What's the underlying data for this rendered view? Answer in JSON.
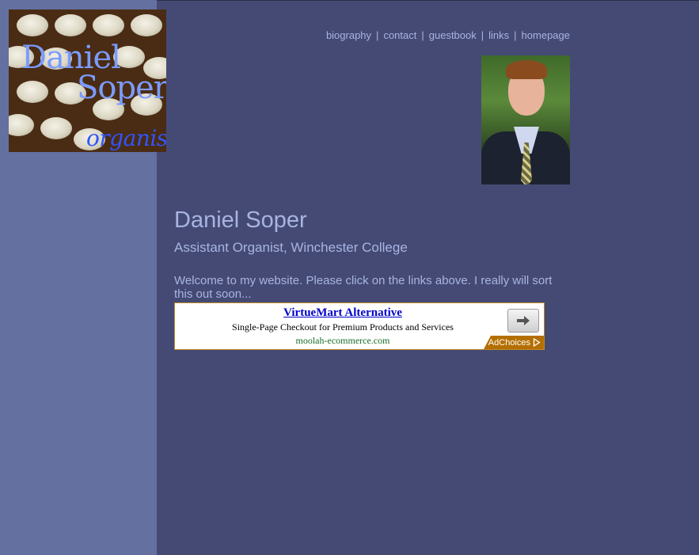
{
  "logo": {
    "line1": "Daniel",
    "line2": "Soper",
    "line3": "organist"
  },
  "nav": {
    "items": [
      "biography",
      "contact",
      "guestbook",
      "links",
      "homepage"
    ],
    "separator": "|"
  },
  "profile": {
    "name": "Daniel Soper",
    "role": "Assistant Organist, Winchester College",
    "welcome": "Welcome to my website. Please click on the links above. I really will sort this out soon..."
  },
  "ad": {
    "title": "VirtueMart Alternative",
    "description": "Single-Page Checkout for Premium Products and Services",
    "url": "moolah-ecommerce.com",
    "choices_label": "AdChoices",
    "arrow_icon": "arrow-right-icon",
    "choices_icon": "adchoices-icon"
  },
  "colors": {
    "background": "#454a75",
    "sidebar": "#6470a0",
    "text": "#a8b4e0",
    "ad_border": "#c08a2a",
    "adchoices_bg": "#b46f00"
  }
}
